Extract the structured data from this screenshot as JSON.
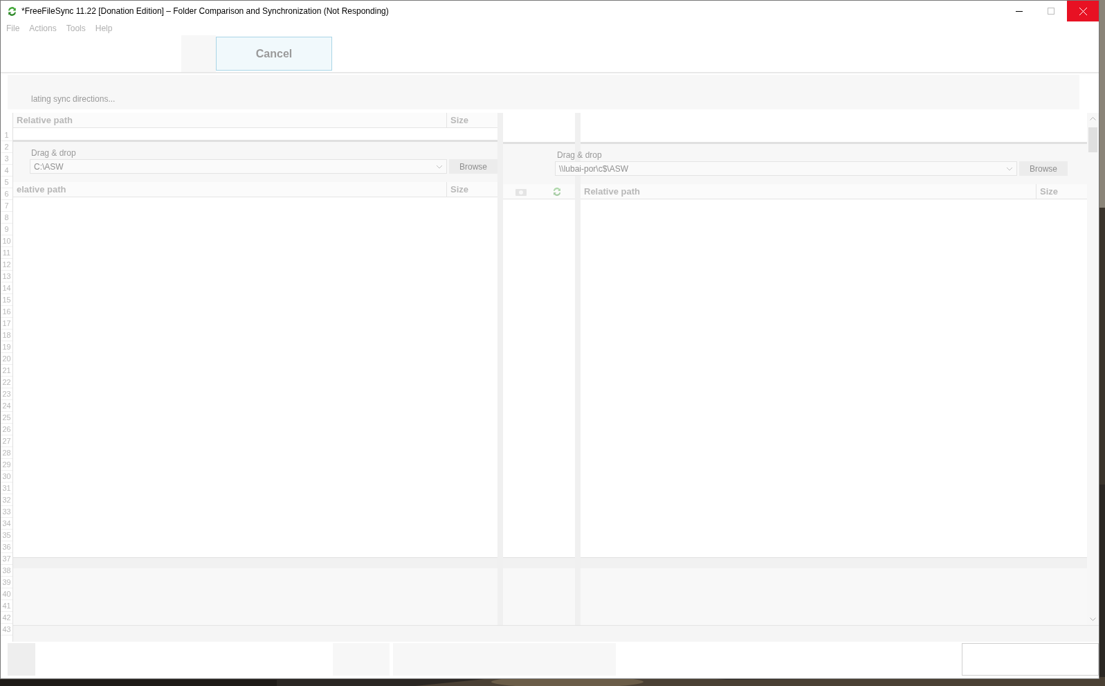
{
  "window": {
    "title": "*FreeFileSync 11.22 [Donation Edition] – Folder Comparison and Synchronization (Not Responding)"
  },
  "menu": [
    "File",
    "Actions",
    "Tools",
    "Help"
  ],
  "toolbar": {
    "cancel_button": "Cancel"
  },
  "status": {
    "text": "lating sync directions..."
  },
  "top_grid": {
    "columns": [
      "Relative path",
      "Size"
    ]
  },
  "row_numbers": [
    "1",
    "2",
    "3",
    "4",
    "5",
    "6",
    "7",
    "8",
    "9",
    "10",
    "11",
    "12",
    "13",
    "14",
    "15",
    "16",
    "17",
    "18",
    "19",
    "20",
    "21",
    "22",
    "23",
    "24",
    "25",
    "26",
    "27",
    "28",
    "29",
    "30",
    "31",
    "32",
    "33",
    "34",
    "35",
    "36",
    "37",
    "38",
    "39",
    "40",
    "41",
    "42",
    "43"
  ],
  "left_folder": {
    "label": "Drag & drop",
    "path": "C:\\ASW",
    "browse": "Browse"
  },
  "right_folder": {
    "label": "Drag & drop",
    "path": "\\\\lubai-por\\c$\\ASW",
    "browse": "Browse"
  },
  "left_grid": {
    "columns": [
      "elative path",
      "Size"
    ]
  },
  "right_grid": {
    "columns": [
      "Relative path",
      "Size"
    ]
  }
}
